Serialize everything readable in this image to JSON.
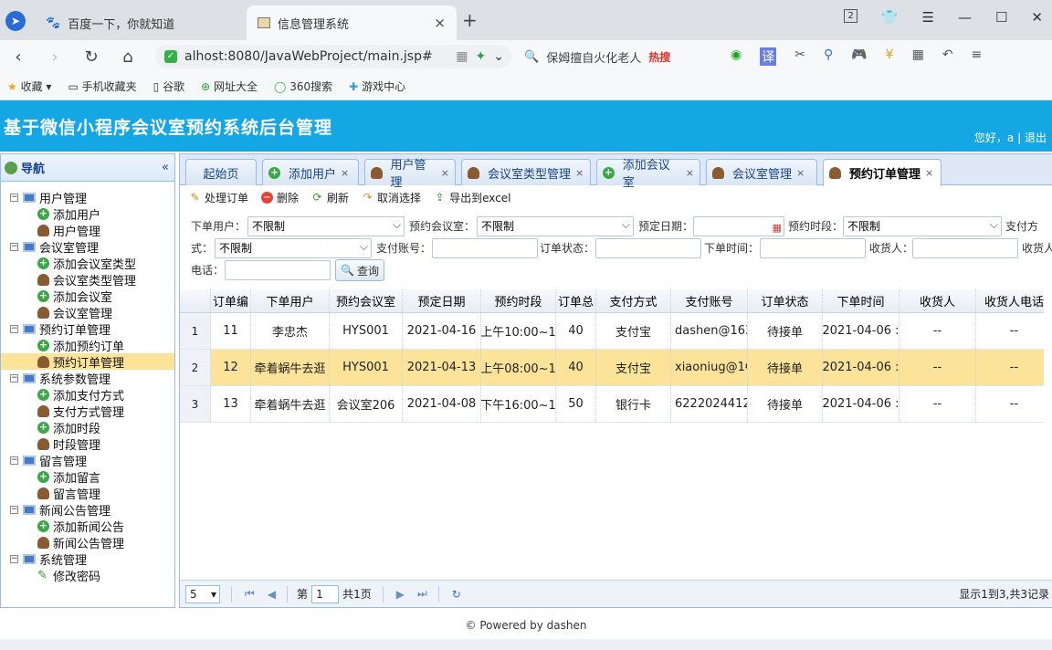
{
  "browser": {
    "tabs": [
      {
        "title": "百度一下，你就知道",
        "close": "×"
      },
      {
        "title": "信息管理系统",
        "close": "×"
      }
    ],
    "new_tab": "+",
    "tab_count": "2",
    "url": "alhost:8080/JavaWebProject/main.jsp#",
    "search_text": "保姆擅自火化老人",
    "search_hot": "热搜",
    "bookmarks": [
      "收藏",
      "手机收藏夹",
      "谷歌",
      "网址大全",
      "360搜索",
      "游戏中心"
    ]
  },
  "app": {
    "title": "基于微信小程序会议室预约系统后台管理",
    "greeting": "您好，a",
    "divider": "|",
    "logout": "退出"
  },
  "sidebar": {
    "header": "导航",
    "collapse": "«",
    "tree": [
      {
        "label": "用户管理",
        "type": "group"
      },
      {
        "label": "添加用户",
        "type": "add"
      },
      {
        "label": "用户管理",
        "type": "user"
      },
      {
        "label": "会议室管理",
        "type": "group"
      },
      {
        "label": "添加会议室类型",
        "type": "add"
      },
      {
        "label": "会议室类型管理",
        "type": "user"
      },
      {
        "label": "添加会议室",
        "type": "add"
      },
      {
        "label": "会议室管理",
        "type": "user"
      },
      {
        "label": "预约订单管理",
        "type": "group"
      },
      {
        "label": "添加预约订单",
        "type": "add"
      },
      {
        "label": "预约订单管理",
        "type": "user",
        "selected": true
      },
      {
        "label": "系统参数管理",
        "type": "group"
      },
      {
        "label": "添加支付方式",
        "type": "add"
      },
      {
        "label": "支付方式管理",
        "type": "user"
      },
      {
        "label": "添加时段",
        "type": "add"
      },
      {
        "label": "时段管理",
        "type": "user"
      },
      {
        "label": "留言管理",
        "type": "group"
      },
      {
        "label": "添加留言",
        "type": "add"
      },
      {
        "label": "留言管理",
        "type": "user"
      },
      {
        "label": "新闻公告管理",
        "type": "group"
      },
      {
        "label": "添加新闻公告",
        "type": "add"
      },
      {
        "label": "新闻公告管理",
        "type": "user"
      },
      {
        "label": "系统管理",
        "type": "group"
      },
      {
        "label": "修改密码",
        "type": "pen"
      }
    ]
  },
  "page_tabs": [
    {
      "label": "起始页",
      "icon": "",
      "closable": false
    },
    {
      "label": "添加用户",
      "icon": "add",
      "closable": true
    },
    {
      "label": "用户管理",
      "icon": "user",
      "closable": true
    },
    {
      "label": "会议室类型管理",
      "icon": "user",
      "closable": true
    },
    {
      "label": "添加会议室",
      "icon": "add",
      "closable": true
    },
    {
      "label": "会议室管理",
      "icon": "user",
      "closable": true
    },
    {
      "label": "预约订单管理",
      "icon": "user",
      "closable": true,
      "active": true
    }
  ],
  "toolbar": {
    "edit": "处理订单",
    "delete": "删除",
    "refresh": "刷新",
    "cancel": "取消选择",
    "export": "导出到excel"
  },
  "filters": {
    "user_label": "下单用户：",
    "user_value": "不限制",
    "room_label": "预约会议室：",
    "room_value": "不限制",
    "date_label": "预定日期：",
    "date_value": "",
    "slot_label": "预约时段：",
    "slot_value": "不限制",
    "pay_label_a": "支付方",
    "pay_label_b": "式：",
    "pay_value": "不限制",
    "account_label": "支付账号：",
    "account_value": "",
    "status_label": "订单状态：",
    "status_value": "",
    "time_label": "下单时间：",
    "time_value": "",
    "receiver_label": "收货人：",
    "receiver_value": "",
    "phone_label_a": "收货人",
    "phone_label_b": "电话：",
    "phone_value": "",
    "query": "查询"
  },
  "grid": {
    "columns": [
      "订单编",
      "下单用户",
      "预约会议室",
      "预定日期",
      "预约时段",
      "订单总",
      "支付方式",
      "支付账号",
      "订单状态",
      "下单时间",
      "收货人",
      "收货人电话"
    ],
    "rows": [
      {
        "num": "1",
        "cells": [
          "11",
          "李忠杰",
          "HYS001",
          "2021-04-16",
          "上午10:00~1",
          "40",
          "支付宝",
          "dashen@163",
          "待接单",
          "2021-04-06 :",
          "--",
          "--"
        ]
      },
      {
        "num": "2",
        "selected": true,
        "cells": [
          "12",
          "牵着蜗牛去逛",
          "HYS001",
          "2021-04-13",
          "上午08:00~1",
          "40",
          "支付宝",
          "xiaoniug@1€",
          "待接单",
          "2021-04-06 :",
          "--",
          "--"
        ]
      },
      {
        "num": "3",
        "cells": [
          "13",
          "牵着蜗牛去逛",
          "会议室206",
          "2021-04-08",
          "下午16:00~1",
          "50",
          "银行卡",
          "6222024412",
          "待接单",
          "2021-04-06 :",
          "--",
          "--"
        ]
      }
    ]
  },
  "pager": {
    "page_size": "5",
    "page_label": "第",
    "page_value": "1",
    "page_total": "共1页",
    "info": "显示1到3,共3记录"
  },
  "footer": "© Powered by dashen"
}
